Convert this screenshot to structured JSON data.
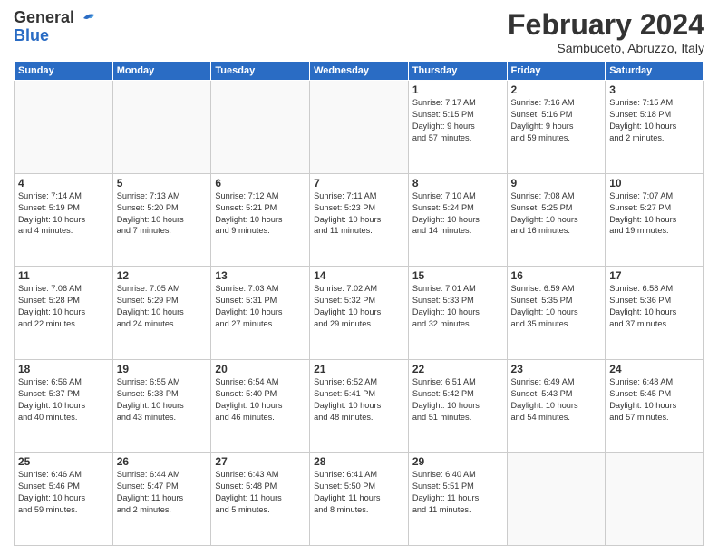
{
  "header": {
    "logo_general": "General",
    "logo_blue": "Blue",
    "month_title": "February 2024",
    "location": "Sambuceto, Abruzzo, Italy"
  },
  "days_of_week": [
    "Sunday",
    "Monday",
    "Tuesday",
    "Wednesday",
    "Thursday",
    "Friday",
    "Saturday"
  ],
  "weeks": [
    [
      {
        "day": "",
        "info": ""
      },
      {
        "day": "",
        "info": ""
      },
      {
        "day": "",
        "info": ""
      },
      {
        "day": "",
        "info": ""
      },
      {
        "day": "1",
        "info": "Sunrise: 7:17 AM\nSunset: 5:15 PM\nDaylight: 9 hours\nand 57 minutes."
      },
      {
        "day": "2",
        "info": "Sunrise: 7:16 AM\nSunset: 5:16 PM\nDaylight: 9 hours\nand 59 minutes."
      },
      {
        "day": "3",
        "info": "Sunrise: 7:15 AM\nSunset: 5:18 PM\nDaylight: 10 hours\nand 2 minutes."
      }
    ],
    [
      {
        "day": "4",
        "info": "Sunrise: 7:14 AM\nSunset: 5:19 PM\nDaylight: 10 hours\nand 4 minutes."
      },
      {
        "day": "5",
        "info": "Sunrise: 7:13 AM\nSunset: 5:20 PM\nDaylight: 10 hours\nand 7 minutes."
      },
      {
        "day": "6",
        "info": "Sunrise: 7:12 AM\nSunset: 5:21 PM\nDaylight: 10 hours\nand 9 minutes."
      },
      {
        "day": "7",
        "info": "Sunrise: 7:11 AM\nSunset: 5:23 PM\nDaylight: 10 hours\nand 11 minutes."
      },
      {
        "day": "8",
        "info": "Sunrise: 7:10 AM\nSunset: 5:24 PM\nDaylight: 10 hours\nand 14 minutes."
      },
      {
        "day": "9",
        "info": "Sunrise: 7:08 AM\nSunset: 5:25 PM\nDaylight: 10 hours\nand 16 minutes."
      },
      {
        "day": "10",
        "info": "Sunrise: 7:07 AM\nSunset: 5:27 PM\nDaylight: 10 hours\nand 19 minutes."
      }
    ],
    [
      {
        "day": "11",
        "info": "Sunrise: 7:06 AM\nSunset: 5:28 PM\nDaylight: 10 hours\nand 22 minutes."
      },
      {
        "day": "12",
        "info": "Sunrise: 7:05 AM\nSunset: 5:29 PM\nDaylight: 10 hours\nand 24 minutes."
      },
      {
        "day": "13",
        "info": "Sunrise: 7:03 AM\nSunset: 5:31 PM\nDaylight: 10 hours\nand 27 minutes."
      },
      {
        "day": "14",
        "info": "Sunrise: 7:02 AM\nSunset: 5:32 PM\nDaylight: 10 hours\nand 29 minutes."
      },
      {
        "day": "15",
        "info": "Sunrise: 7:01 AM\nSunset: 5:33 PM\nDaylight: 10 hours\nand 32 minutes."
      },
      {
        "day": "16",
        "info": "Sunrise: 6:59 AM\nSunset: 5:35 PM\nDaylight: 10 hours\nand 35 minutes."
      },
      {
        "day": "17",
        "info": "Sunrise: 6:58 AM\nSunset: 5:36 PM\nDaylight: 10 hours\nand 37 minutes."
      }
    ],
    [
      {
        "day": "18",
        "info": "Sunrise: 6:56 AM\nSunset: 5:37 PM\nDaylight: 10 hours\nand 40 minutes."
      },
      {
        "day": "19",
        "info": "Sunrise: 6:55 AM\nSunset: 5:38 PM\nDaylight: 10 hours\nand 43 minutes."
      },
      {
        "day": "20",
        "info": "Sunrise: 6:54 AM\nSunset: 5:40 PM\nDaylight: 10 hours\nand 46 minutes."
      },
      {
        "day": "21",
        "info": "Sunrise: 6:52 AM\nSunset: 5:41 PM\nDaylight: 10 hours\nand 48 minutes."
      },
      {
        "day": "22",
        "info": "Sunrise: 6:51 AM\nSunset: 5:42 PM\nDaylight: 10 hours\nand 51 minutes."
      },
      {
        "day": "23",
        "info": "Sunrise: 6:49 AM\nSunset: 5:43 PM\nDaylight: 10 hours\nand 54 minutes."
      },
      {
        "day": "24",
        "info": "Sunrise: 6:48 AM\nSunset: 5:45 PM\nDaylight: 10 hours\nand 57 minutes."
      }
    ],
    [
      {
        "day": "25",
        "info": "Sunrise: 6:46 AM\nSunset: 5:46 PM\nDaylight: 10 hours\nand 59 minutes."
      },
      {
        "day": "26",
        "info": "Sunrise: 6:44 AM\nSunset: 5:47 PM\nDaylight: 11 hours\nand 2 minutes."
      },
      {
        "day": "27",
        "info": "Sunrise: 6:43 AM\nSunset: 5:48 PM\nDaylight: 11 hours\nand 5 minutes."
      },
      {
        "day": "28",
        "info": "Sunrise: 6:41 AM\nSunset: 5:50 PM\nDaylight: 11 hours\nand 8 minutes."
      },
      {
        "day": "29",
        "info": "Sunrise: 6:40 AM\nSunset: 5:51 PM\nDaylight: 11 hours\nand 11 minutes."
      },
      {
        "day": "",
        "info": ""
      },
      {
        "day": "",
        "info": ""
      }
    ]
  ]
}
